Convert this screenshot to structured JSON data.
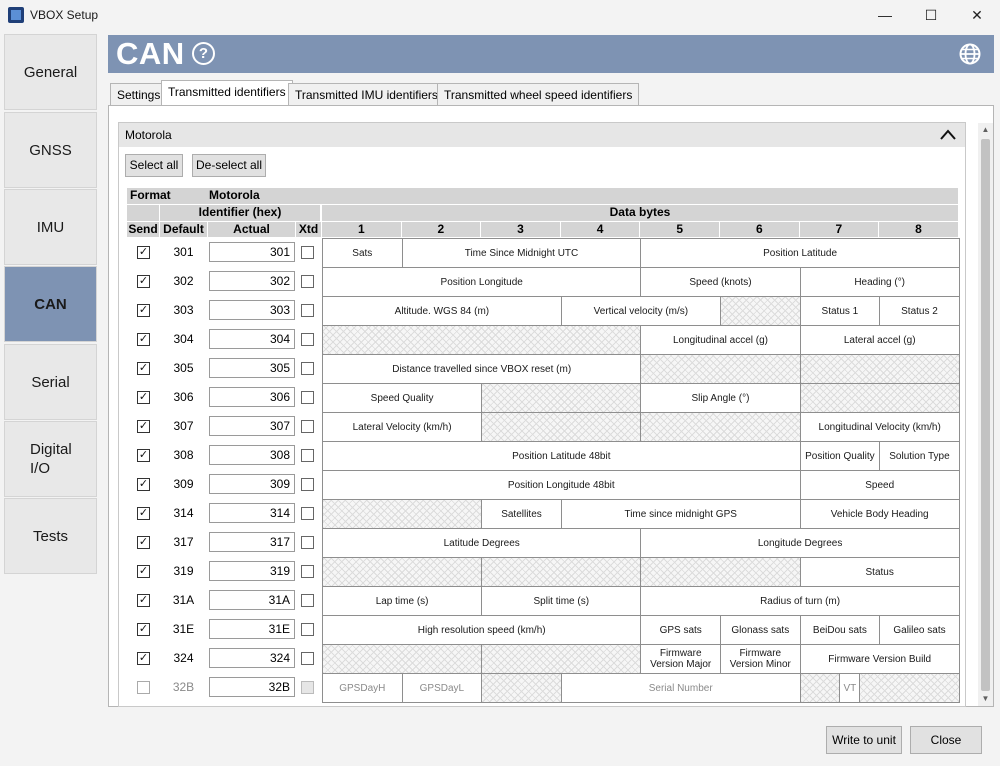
{
  "window": {
    "title": "VBOX Setup",
    "minimize": "—",
    "maximize": "☐",
    "close": "✕"
  },
  "sidebar": {
    "items": [
      {
        "label": "General"
      },
      {
        "label": "GNSS"
      },
      {
        "label": "IMU"
      },
      {
        "label": "CAN",
        "active": true
      },
      {
        "label": "Serial"
      },
      {
        "label": "Digital I/O"
      },
      {
        "label": "Tests"
      }
    ]
  },
  "header": {
    "title": "CAN",
    "help": "?"
  },
  "tabs": [
    {
      "label": "Settings"
    },
    {
      "label": "Transmitted identifiers",
      "active": true
    },
    {
      "label": "Transmitted IMU identifiers"
    },
    {
      "label": "Transmitted wheel speed identifiers"
    }
  ],
  "group": {
    "title": "Motorola",
    "select_all": "Select all",
    "deselect_all": "De-select all"
  },
  "table": {
    "format_label": "Format",
    "format_value": "Motorola",
    "identifier_header": "Identifier (hex)",
    "data_bytes_header": "Data bytes",
    "col_send": "Send",
    "col_default": "Default",
    "col_actual": "Actual",
    "col_xtd": "Xtd",
    "byte_numbers": [
      "1",
      "2",
      "3",
      "4",
      "5",
      "6",
      "7",
      "8"
    ],
    "rows": [
      {
        "id": "301",
        "send": true,
        "cells": [
          [
            "Sats",
            1
          ],
          [
            "Time Since Midnight UTC",
            3
          ],
          [
            "Position Latitude",
            4
          ]
        ]
      },
      {
        "id": "302",
        "send": true,
        "cells": [
          [
            "Position Longitude",
            4
          ],
          [
            "Speed (knots)",
            2
          ],
          [
            "Heading (°)",
            2
          ]
        ]
      },
      {
        "id": "303",
        "send": true,
        "cells": [
          [
            "Altitude.  WGS 84 (m)",
            3
          ],
          [
            "Vertical velocity (m/s)",
            2
          ],
          [
            "",
            1
          ],
          [
            "Status 1",
            1
          ],
          [
            "Status 2",
            1
          ]
        ]
      },
      {
        "id": "304",
        "send": true,
        "cells": [
          [
            "",
            4
          ],
          [
            "Longitudinal accel (g)",
            2
          ],
          [
            "Lateral accel (g)",
            2
          ]
        ]
      },
      {
        "id": "305",
        "send": true,
        "cells": [
          [
            "Distance travelled since VBOX reset (m)",
            4
          ],
          [
            "",
            2
          ],
          [
            "",
            2
          ]
        ]
      },
      {
        "id": "306",
        "send": true,
        "cells": [
          [
            "Speed Quality",
            2
          ],
          [
            "",
            2
          ],
          [
            "Slip Angle (°)",
            2
          ],
          [
            "",
            2
          ]
        ]
      },
      {
        "id": "307",
        "send": true,
        "cells": [
          [
            "Lateral Velocity (km/h)",
            2
          ],
          [
            "",
            2
          ],
          [
            "",
            2
          ],
          [
            "Longitudinal Velocity (km/h)",
            2
          ]
        ]
      },
      {
        "id": "308",
        "send": true,
        "cells": [
          [
            "Position Latitude 48bit",
            6
          ],
          [
            "Position Quality",
            1
          ],
          [
            "Solution Type",
            1
          ]
        ]
      },
      {
        "id": "309",
        "send": true,
        "cells": [
          [
            "Position Longitude 48bit",
            6
          ],
          [
            "Speed",
            2
          ]
        ]
      },
      {
        "id": "314",
        "send": true,
        "cells": [
          [
            "",
            2
          ],
          [
            "Satellites",
            1
          ],
          [
            "Time since midnight GPS",
            3
          ],
          [
            "Vehicle Body Heading",
            2
          ]
        ]
      },
      {
        "id": "317",
        "send": true,
        "cells": [
          [
            "Latitude Degrees",
            4
          ],
          [
            "Longitude Degrees",
            4
          ]
        ]
      },
      {
        "id": "319",
        "send": true,
        "cells": [
          [
            "",
            2
          ],
          [
            "",
            2
          ],
          [
            "",
            2
          ],
          [
            "Status",
            2
          ]
        ]
      },
      {
        "id": "31A",
        "send": true,
        "cells": [
          [
            "Lap time (s)",
            2
          ],
          [
            "Split time (s)",
            2
          ],
          [
            "Radius of turn (m)",
            4
          ]
        ]
      },
      {
        "id": "31E",
        "send": true,
        "cells": [
          [
            "High resolution speed (km/h)",
            4
          ],
          [
            "GPS sats",
            1
          ],
          [
            "Glonass sats",
            1
          ],
          [
            "BeiDou sats",
            1
          ],
          [
            "Galileo sats",
            1
          ]
        ]
      },
      {
        "id": "324",
        "send": true,
        "cells": [
          [
            "",
            2
          ],
          [
            "",
            2
          ],
          [
            "Firmware Version Major",
            1
          ],
          [
            "Firmware Version Minor",
            1
          ],
          [
            "Firmware Version Build",
            2
          ]
        ]
      },
      {
        "id": "32B",
        "send": false,
        "disabled": true,
        "cells": [
          [
            "GPSDayH",
            1
          ],
          [
            "GPSDayL",
            1
          ],
          [
            "",
            1
          ],
          [
            "Serial Number",
            3
          ],
          [
            "",
            0.5
          ],
          [
            "VT",
            0.25
          ],
          [
            "",
            1.25
          ]
        ]
      }
    ]
  },
  "footer": {
    "write": "Write to unit",
    "close": "Close"
  }
}
